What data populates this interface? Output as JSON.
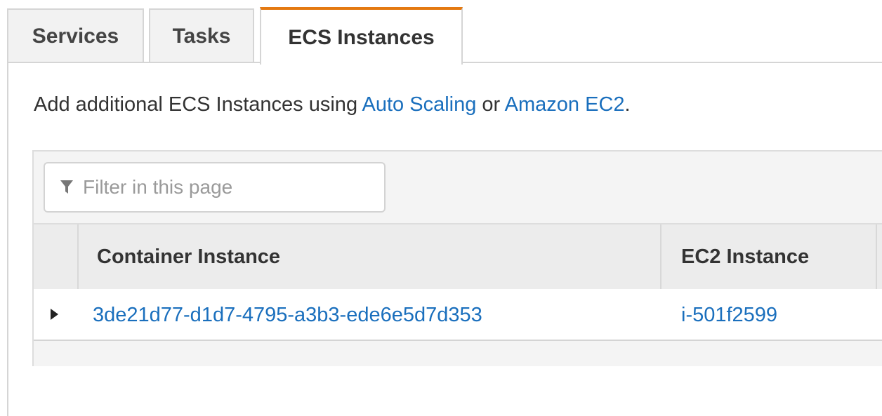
{
  "tabs": [
    {
      "label": "Services",
      "active": false
    },
    {
      "label": "Tasks",
      "active": false
    },
    {
      "label": "ECS Instances",
      "active": true
    }
  ],
  "info": {
    "prefix": "Add additional ECS Instances using ",
    "link_auto_scaling": "Auto Scaling",
    "middle": " or ",
    "link_ec2": "Amazon EC2",
    "suffix": "."
  },
  "filter": {
    "placeholder": "Filter in this page",
    "value": "",
    "icon": "filter-icon"
  },
  "table": {
    "columns": [
      "Container Instance",
      "EC2 Instance"
    ],
    "rows": [
      {
        "container_instance": "3de21d77-d1d7-4795-a3b3-ede6e5d7d353",
        "ec2_instance": "i-501f2599",
        "expanded": false
      }
    ]
  },
  "colors": {
    "active_tab_accent": "#e47911",
    "link": "#1a6fbd",
    "header_bg": "#ececec"
  }
}
